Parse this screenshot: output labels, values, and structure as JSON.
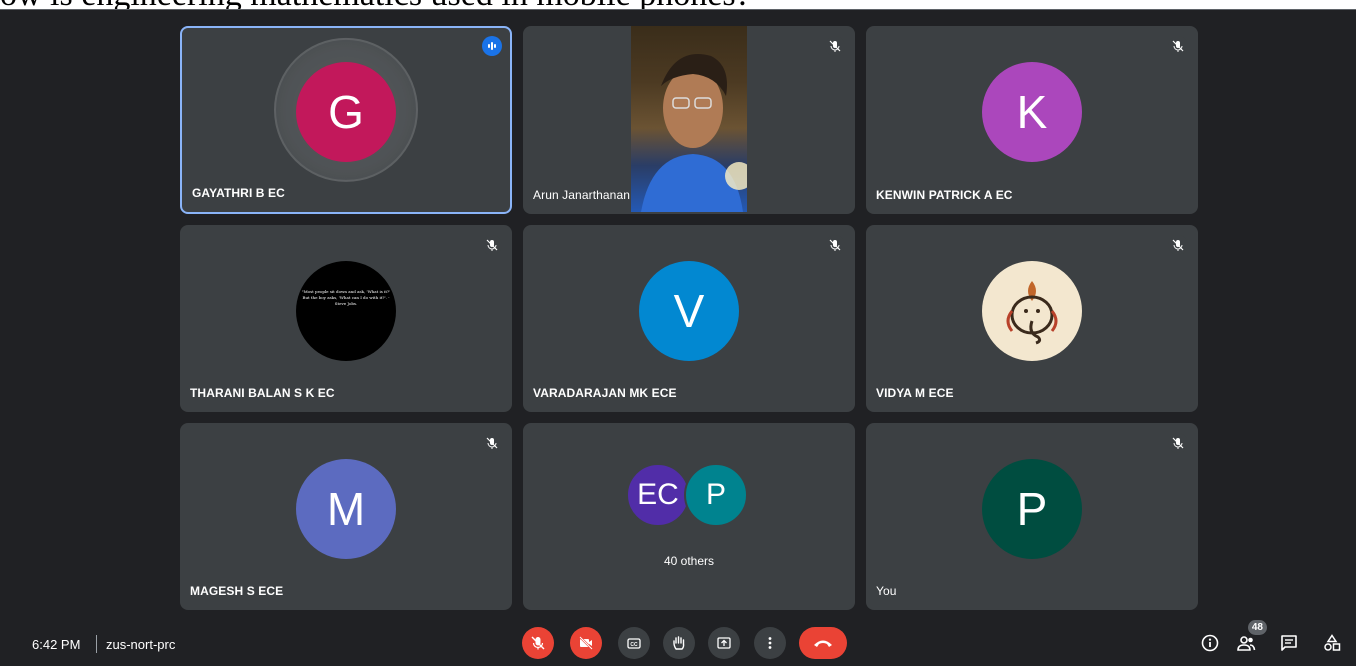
{
  "header": {
    "text": "ow is engineering mathematics used in mobile phones?"
  },
  "tiles": [
    {
      "name": "GAYATHRI B EC",
      "initial": "G",
      "avatar_color": "#c2185b",
      "speaking": true
    },
    {
      "name": "Arun Janarthanan",
      "video": true
    },
    {
      "name": "KENWIN PATRICK A EC",
      "initial": "K",
      "avatar_color": "#ab47bc"
    },
    {
      "name": "THARANI BALAN S K EC",
      "quote": "\"Most people sit down and ask, 'What is it?' But the boy asks, 'What can I do with it?'. -Steve Jobs."
    },
    {
      "name": "VARADARAJAN MK ECE",
      "initial": "V",
      "avatar_color": "#0288d1"
    },
    {
      "name": "VIDYA M ECE",
      "image": "ganesha-avatar"
    },
    {
      "name": "MAGESH S ECE",
      "initial": "M",
      "avatar_color": "#5c6bc0"
    },
    {
      "others_label": "40 others",
      "initials": [
        "EC",
        "P"
      ],
      "colors": [
        "#512da8",
        "#00838f"
      ]
    },
    {
      "name": "You",
      "initial": "P",
      "avatar_color": "#004d40"
    }
  ],
  "bottom": {
    "time": "6:42 PM",
    "meeting_code": "zus-nort-prc",
    "participant_count": "48",
    "controls": [
      "mic-off-icon",
      "camera-off-icon",
      "captions-icon",
      "raise-hand-icon",
      "present-icon",
      "more-options-icon",
      "end-call-icon"
    ],
    "right_controls": [
      "info-icon",
      "people-icon",
      "chat-icon",
      "activities-icon"
    ]
  },
  "colors": {
    "background": "#202124",
    "tile": "#3c4043",
    "accent": "#8ab4f8",
    "danger": "#ea4335"
  }
}
